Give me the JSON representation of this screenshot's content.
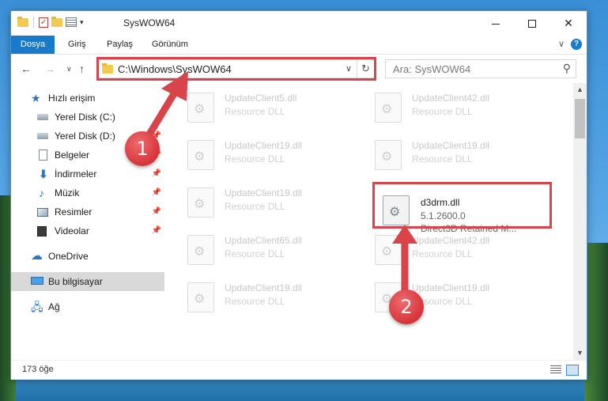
{
  "window": {
    "title": "SysWOW64"
  },
  "ribbon": {
    "tabs": [
      "Dosya",
      "Giriş",
      "Paylaş",
      "Görünüm"
    ],
    "help": "?"
  },
  "address": {
    "path": "C:\\Windows\\SysWOW64",
    "search_placeholder": "Ara: SysWOW64"
  },
  "sidebar": {
    "items": [
      {
        "label": "Hızlı erişim",
        "icon": "star-icon"
      },
      {
        "label": "Yerel Disk (C:)",
        "icon": "drive-icon"
      },
      {
        "label": "Yerel Disk (D:)",
        "icon": "drive-icon"
      },
      {
        "label": "Belgeler",
        "icon": "documents-icon"
      },
      {
        "label": "İndirmeler",
        "icon": "download-icon"
      },
      {
        "label": "Müzik",
        "icon": "music-icon"
      },
      {
        "label": "Resimler",
        "icon": "pictures-icon"
      },
      {
        "label": "Videolar",
        "icon": "videos-icon"
      },
      {
        "label": "OneDrive",
        "icon": "cloud-icon"
      },
      {
        "label": "Bu bilgisayar",
        "icon": "computer-icon"
      },
      {
        "label": "Ağ",
        "icon": "network-icon"
      }
    ],
    "selected": "Bu bilgisayar"
  },
  "files": {
    "left": [
      {
        "name": "UpdateClient5.dll",
        "type": "Resource DLL"
      },
      {
        "name": "UpdateClient19.dll",
        "type": "Resource DLL"
      },
      {
        "name": "UpdateClient19.dll",
        "type": "Resource DLL"
      },
      {
        "name": "UpdateClient65.dll",
        "type": "Resource DLL"
      },
      {
        "name": "UpdateClient19.dll",
        "type": "Resource DLL"
      }
    ],
    "right": [
      {
        "name": "UpdateClient42.dll",
        "type": "Resource DLL"
      },
      {
        "name": "UpdateClient19.dll",
        "type": "Resource DLL"
      },
      {
        "name": "UpdateClient42.dll",
        "type": "Resource DLL"
      },
      {
        "name": "UpdateClient19.dll",
        "type": "Resource DLL"
      }
    ],
    "focused": {
      "name": "d3drm.dll",
      "version": "5.1.2600.0",
      "description": "Direct3D Retained M..."
    }
  },
  "status": {
    "item_count": "173 öğe"
  },
  "annotations": {
    "step1": "1",
    "step2": "2",
    "color": "#d9444a"
  }
}
